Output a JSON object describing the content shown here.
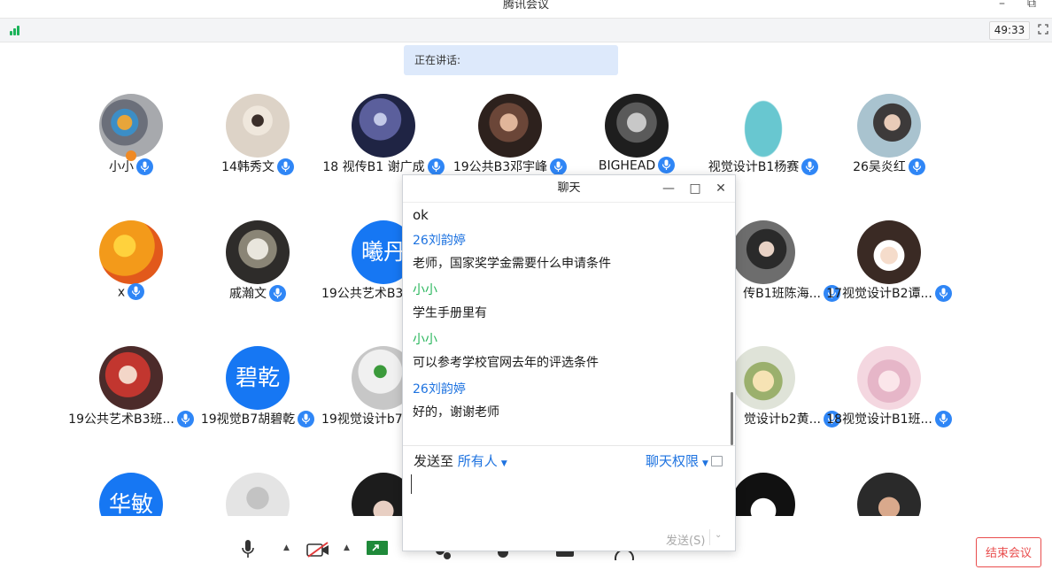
{
  "window": {
    "title": "腾讯会议",
    "minimize_icon": "minimize-icon",
    "restore_icon": "restore-icon"
  },
  "statusbar": {
    "timer": "49:33",
    "signal_color": "#1bb35a"
  },
  "speaking": {
    "label": "正在讲话:"
  },
  "participants": [
    {
      "name": "小小"
    },
    {
      "name": "14韩秀文"
    },
    {
      "name": "18 视传B1 谢广成"
    },
    {
      "name": "19公共B3邓宇峰"
    },
    {
      "name": "BIGHEAD"
    },
    {
      "name": "视觉设计B1杨赛"
    },
    {
      "name": "26吴炎红"
    },
    {
      "name": "x"
    },
    {
      "name": "戚瀚文"
    },
    {
      "name": "19公共艺术B3",
      "avatar_text": "曦丹"
    },
    {
      "name": "传B1班陈海..."
    },
    {
      "name": "17视觉设计B2谭..."
    },
    {
      "name": "19公共艺术B3班..."
    },
    {
      "name": "19视觉B7胡碧乾",
      "avatar_text": "碧乾"
    },
    {
      "name": "19视觉设计b7"
    },
    {
      "name": "觉设计b2黄..."
    },
    {
      "name": "18视觉设计B1班..."
    },
    {
      "avatar_text": "华敏"
    }
  ],
  "chat": {
    "title": "聊天",
    "messages": [
      {
        "text": "ok"
      },
      {
        "sender": "26刘韵婷",
        "text": "老师，国家奖学金需要什么申请条件"
      },
      {
        "sender": "小小",
        "text": "学生手册里有"
      },
      {
        "sender": "小小",
        "text": "可以参考学校官网去年的评选条件"
      },
      {
        "sender": "26刘韵婷",
        "text": "好的，谢谢老师"
      }
    ],
    "send_to_label": "发送至",
    "send_to_value": "所有人",
    "permission_label": "聊天权限",
    "send_button": "发送(S)"
  },
  "end_meeting": "结束会议",
  "colors": {
    "accent": "#1e73e0",
    "avatar_blue": "#1677f3",
    "green_sender": "#26b55a",
    "end_red": "#e94d4d"
  }
}
